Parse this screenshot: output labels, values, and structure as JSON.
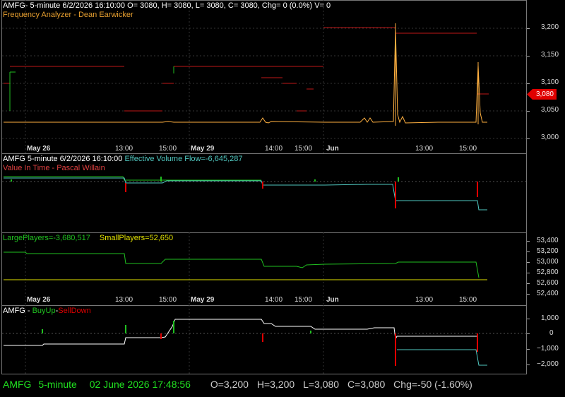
{
  "price_pane": {
    "header": "AMFG- 5-minute 6/2/2026 16:10:00 O= 3080, H= 3080, L= 3080, C= 3080, Chg= 0 (0.0%) V= 0",
    "indicator": "Frequency Analyzer - Dean Earwicker",
    "y_ticks": [
      "3,200",
      "3,150",
      "3,100",
      "3,050",
      "3,000"
    ],
    "last_value": "3,080",
    "colors": {
      "header": "#ffffff",
      "indicator": "#e8a030",
      "price": "#ffb040",
      "freq": "#d02020"
    }
  },
  "x_axis_top": {
    "labels": [
      {
        "text": "May 26",
        "bold": true
      },
      {
        "text": "13:00",
        "bold": false
      },
      {
        "text": "15:00",
        "bold": false
      },
      {
        "text": "May 29",
        "bold": true
      },
      {
        "text": "14:00",
        "bold": false
      },
      {
        "text": "15:00",
        "bold": false
      },
      {
        "text": "Jun",
        "bold": true
      },
      {
        "text": "13:00",
        "bold": false
      },
      {
        "text": "15:00",
        "bold": false
      }
    ]
  },
  "flow_pane": {
    "header_prefix": "AMFG 5-minute  6/2/2026 16:10:00",
    "header_value": "Effective Volume Flow=-6,645,287",
    "indicator": "Value In Time - Pascal Willain"
  },
  "players_pane": {
    "large_label": "LargePlayers=-3,680,517",
    "small_label": "SmallPlayers=52,650",
    "y_ticks": [
      "53,400",
      "53,200",
      "53,000",
      "52,800",
      "52,600",
      "52,400"
    ]
  },
  "x_axis_bottom": {
    "labels": [
      {
        "text": "May 26",
        "bold": true
      },
      {
        "text": "13:00",
        "bold": false
      },
      {
        "text": "15:00",
        "bold": false
      },
      {
        "text": "May 29",
        "bold": true
      },
      {
        "text": "14:00",
        "bold": false
      },
      {
        "text": "15:00",
        "bold": false
      },
      {
        "text": "Jun",
        "bold": true
      },
      {
        "text": "13:00",
        "bold": false
      },
      {
        "text": "15:00",
        "bold": false
      }
    ]
  },
  "buyup_pane": {
    "prefix": "AMFG - ",
    "buy": "BuyUp",
    "dash": "-",
    "sell": "SellDown",
    "y_ticks": [
      "1,000",
      "0",
      "−1,000",
      "−2,000"
    ]
  },
  "status_bar": {
    "symbol": "AMFG",
    "interval": "5-minute",
    "date": "02 June 2026 17:48:56",
    "open": "O=3,200",
    "high": "H=3,200",
    "low": "L=3,080",
    "close": "C=3,080",
    "change": "Chg=-50 (-1.60%)"
  }
}
